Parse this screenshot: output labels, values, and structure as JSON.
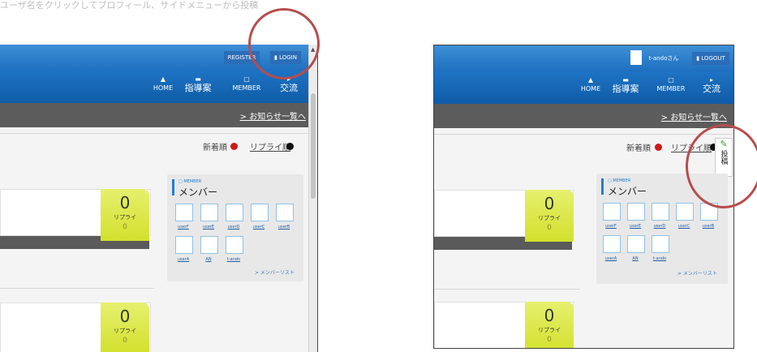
{
  "caption": "ユーザ名をクリックしてプロフィール、サイドメニューから投稿",
  "left_panel": {
    "topbar": {
      "register_label": "REGISTER",
      "login_label": "LOGIN"
    },
    "nav": [
      {
        "icon": "home-icon",
        "label": "HOME"
      },
      {
        "icon": "bubble-icon",
        "label": "指導案"
      },
      {
        "icon": "member-icon",
        "label": "MEMBER"
      },
      {
        "icon": "flag-icon",
        "label": "交流"
      }
    ],
    "notice_link": "> お知らせ一覧へ",
    "sort": {
      "new_label": "新着順",
      "reply_label": "リプライ順"
    },
    "posts": [
      {
        "reply_count": "0",
        "reply_label": "リプライ",
        "reply_sub": "0"
      },
      {
        "reply_count": "0",
        "reply_label": "リプライ",
        "reply_sub": "0"
      }
    ],
    "members": {
      "sub_label": "MEMBER",
      "title": "メンバー",
      "names": [
        "userF",
        "userE",
        "userD",
        "userC",
        "userB",
        "userA",
        "AN",
        "t-ando"
      ],
      "list_link": "> メンバーリスト"
    }
  },
  "right_panel": {
    "topbar": {
      "user_label": "t-andoさん",
      "logout_label": "LOGOUT"
    },
    "nav": [
      {
        "icon": "home-icon",
        "label": "HOME"
      },
      {
        "icon": "bubble-icon",
        "label": "指導案"
      },
      {
        "icon": "member-icon",
        "label": "MEMBER"
      },
      {
        "icon": "flag-icon",
        "label": "交流"
      }
    ],
    "notice_link": "> お知らせ一覧へ",
    "sort": {
      "new_label": "新着順",
      "reply_label": "リプライ順"
    },
    "post_tab_label": "投稿",
    "posts": [
      {
        "reply_count": "0",
        "reply_label": "リプライ",
        "reply_sub": "0"
      },
      {
        "reply_count": "0",
        "reply_label": "リプライ",
        "reply_sub": "0"
      }
    ],
    "members": {
      "sub_label": "MEMBER",
      "title": "メンバー",
      "names": [
        "userF",
        "userE",
        "userD",
        "userC",
        "userB",
        "userA",
        "AN",
        "t-ando"
      ],
      "list_link": "> メンバーリスト"
    }
  },
  "colors": {
    "header_blue": "#1f70bf",
    "notice_bar": "#5c5c5c",
    "reply_badge": "#d8e43a",
    "highlight": "#b84c4c"
  }
}
